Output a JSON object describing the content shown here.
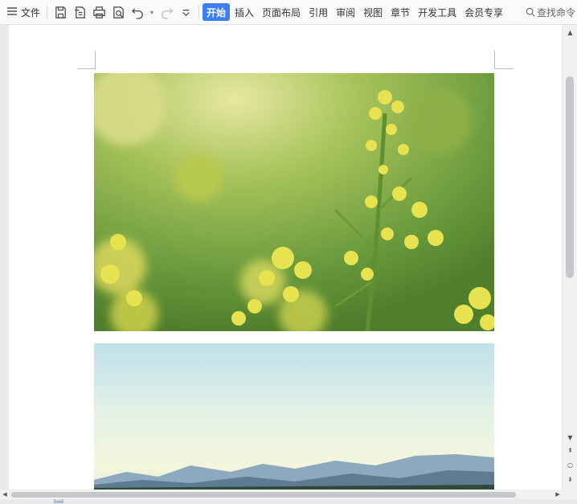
{
  "toolbar": {
    "file_label": "文件",
    "tabs": [
      {
        "label": "开始",
        "active": true
      },
      {
        "label": "插入"
      },
      {
        "label": "页面布局"
      },
      {
        "label": "引用"
      },
      {
        "label": "审阅"
      },
      {
        "label": "视图"
      },
      {
        "label": "章节"
      },
      {
        "label": "开发工具"
      },
      {
        "label": "会员专享"
      }
    ],
    "search_label": "查找命令",
    "icons": [
      "menu-icon",
      "save-icon",
      "export-pdf-icon",
      "print-icon",
      "print-preview-icon",
      "undo-icon",
      "redo-icon",
      "more-icon",
      "search-icon"
    ]
  },
  "document": {
    "images": [
      {
        "name": "rapeseed-flowers-photo",
        "colors": [
          "#6f9a3a",
          "#c9d94a",
          "#e8e36a"
        ]
      },
      {
        "name": "mountain-landscape-photo",
        "colors": [
          "#bfe0ea",
          "#f3f6dc",
          "#4e6a86"
        ]
      }
    ]
  },
  "accent_color": "#3d7ef5"
}
